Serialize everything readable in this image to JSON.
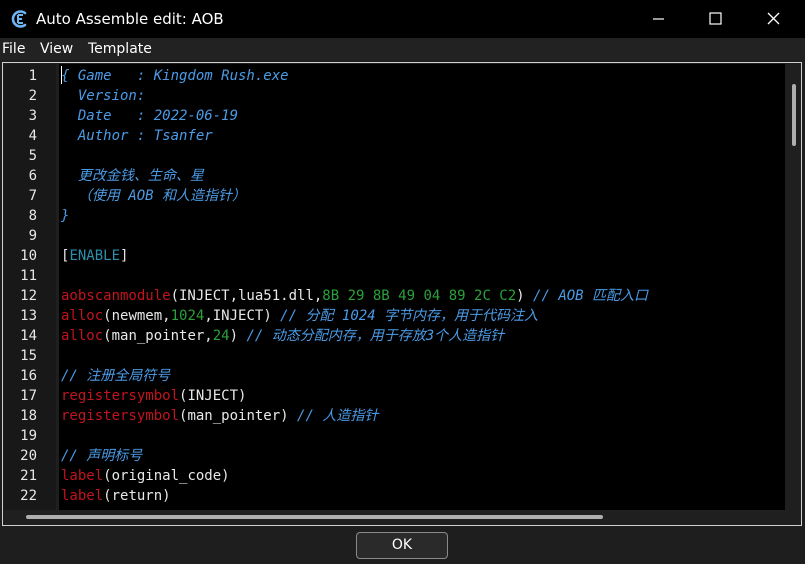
{
  "window": {
    "title": "Auto Assemble edit: AOB",
    "app_icon": "cheat-engine-icon"
  },
  "menu": {
    "items": [
      "File",
      "View",
      "Template"
    ]
  },
  "editor": {
    "lines": [
      [
        {
          "t": "{ Game   : Kingdom Rush.exe",
          "c": "cm"
        }
      ],
      [
        {
          "t": "  Version:",
          "c": "cm"
        }
      ],
      [
        {
          "t": "  Date   : 2022-06-19",
          "c": "cm"
        }
      ],
      [
        {
          "t": "  Author : Tsanfer",
          "c": "cm"
        }
      ],
      [],
      [
        {
          "t": "  更改金钱、生命、星",
          "c": "cm"
        }
      ],
      [
        {
          "t": "  （使用 AOB 和人造指针）",
          "c": "cm"
        }
      ],
      [
        {
          "t": "}",
          "c": "cm"
        }
      ],
      [],
      [
        {
          "t": "[",
          "c": "txt"
        },
        {
          "t": "ENABLE",
          "c": "sec"
        },
        {
          "t": "]",
          "c": "txt"
        }
      ],
      [],
      [
        {
          "t": "aobscanmodule",
          "c": "kw"
        },
        {
          "t": "(INJECT,lua51.dll,",
          "c": "txt"
        },
        {
          "t": "8B 29 8B 49 04 89 2C C2",
          "c": "num"
        },
        {
          "t": ") ",
          "c": "txt"
        },
        {
          "t": "// AOB 匹配入口",
          "c": "cm"
        }
      ],
      [
        {
          "t": "alloc",
          "c": "kw"
        },
        {
          "t": "(newmem,",
          "c": "txt"
        },
        {
          "t": "1024",
          "c": "num"
        },
        {
          "t": ",INJECT) ",
          "c": "txt"
        },
        {
          "t": "// 分配 1024 字节内存，用于代码注入",
          "c": "cm"
        }
      ],
      [
        {
          "t": "alloc",
          "c": "kw"
        },
        {
          "t": "(man_pointer,",
          "c": "txt"
        },
        {
          "t": "24",
          "c": "num"
        },
        {
          "t": ") ",
          "c": "txt"
        },
        {
          "t": "// 动态分配内存，用于存放3个人造指针",
          "c": "cm"
        }
      ],
      [],
      [
        {
          "t": "// 注册全局符号",
          "c": "cm"
        }
      ],
      [
        {
          "t": "registersymbol",
          "c": "kw"
        },
        {
          "t": "(INJECT)",
          "c": "txt"
        }
      ],
      [
        {
          "t": "registersymbol",
          "c": "kw"
        },
        {
          "t": "(man_pointer) ",
          "c": "txt"
        },
        {
          "t": "// 人造指针",
          "c": "cm"
        }
      ],
      [],
      [
        {
          "t": "// 声明标号",
          "c": "cm"
        }
      ],
      [
        {
          "t": "label",
          "c": "kw"
        },
        {
          "t": "(original_code)",
          "c": "txt"
        }
      ],
      [
        {
          "t": "label",
          "c": "kw"
        },
        {
          "t": "(return)",
          "c": "txt"
        }
      ]
    ],
    "line_numbers": [
      "1",
      "2",
      "3",
      "4",
      "5",
      "6",
      "7",
      "8",
      "9",
      "10",
      "11",
      "12",
      "13",
      "14",
      "15",
      "16",
      "17",
      "18",
      "19",
      "20",
      "21",
      "22"
    ]
  },
  "footer": {
    "ok_label": "OK"
  }
}
